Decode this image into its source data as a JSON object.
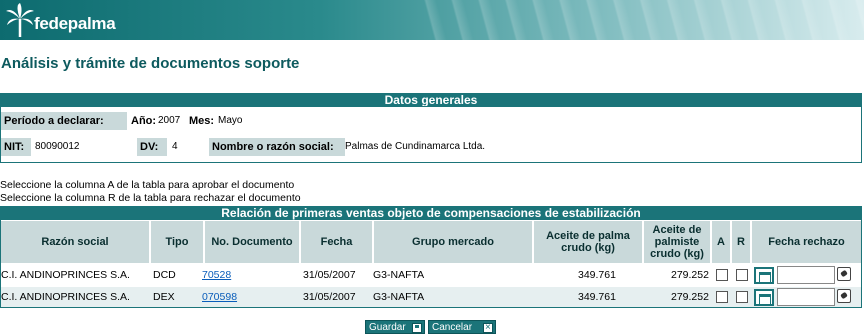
{
  "brand": {
    "name": "fedepalma"
  },
  "page_title": "Análisis y trámite de documentos soporte",
  "datos_generales": {
    "header": "Datos generales",
    "periodo_label": "Período a declarar:",
    "anio_label": "Año:",
    "anio_value": "2007",
    "mes_label": "Mes:",
    "mes_value": "Mayo",
    "nit_label": "NIT:",
    "nit_value": "80090012",
    "dv_label": "DV:",
    "dv_value": "4",
    "razon_label": "Nombre o razón social:",
    "razon_value": "Palmas de Cundinamarca Ltda."
  },
  "instructions": [
    "Seleccione la columna A de la tabla para aprobar el documento",
    "Seleccione la columna R de la tabla para rechazar el documento"
  ],
  "table": {
    "title": "Relación de primeras ventas objeto de compensaciones de estabilización",
    "columns": {
      "razon": "Razón social",
      "tipo": "Tipo",
      "documento": "No. Documento",
      "fecha": "Fecha",
      "grupo": "Grupo mercado",
      "palma": "Aceite de palma crudo (kg)",
      "palmiste": "Aceite de palmiste crudo (kg)",
      "a": "A",
      "r": "R",
      "rechazo": "Fecha rechazo"
    },
    "rows": [
      {
        "razon": "C.I. ANDINOPRINCES S.A.",
        "tipo": "DCD",
        "documento": "70528",
        "fecha": "31/05/2007",
        "grupo": "G3-NAFTA",
        "palma": "349.761",
        "palmiste": "279.252"
      },
      {
        "razon": "C.I. ANDINOPRINCES S.A.",
        "tipo": "DEX",
        "documento": "070598",
        "fecha": "31/05/2007",
        "grupo": "G3-NAFTA",
        "palma": "349.761",
        "palmiste": "279.252"
      }
    ]
  },
  "buttons": {
    "save": "Guardar",
    "cancel": "Cancelar"
  },
  "icons": {
    "logo": "palm-tree-icon",
    "calendar": "calendar-icon",
    "clear": "eraser-icon",
    "save": "floppy-disk-icon",
    "cancel": "close-icon"
  },
  "colors": {
    "primary": "#1b7479",
    "label_bg": "#c9d9da",
    "title": "#0d5a5e",
    "link": "#0a5dba"
  }
}
